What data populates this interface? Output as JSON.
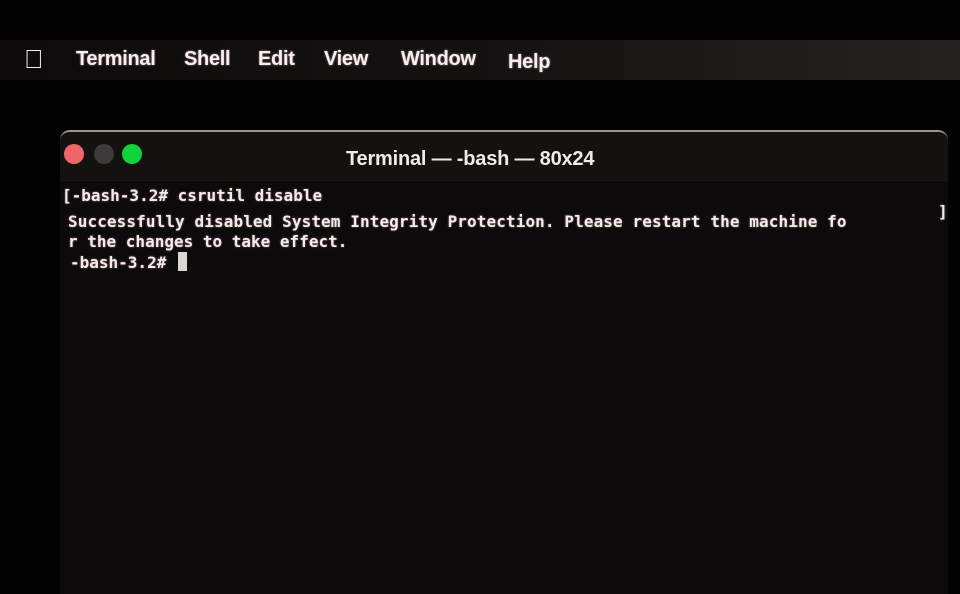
{
  "menubar": {
    "apple_icon": "apple-logo-icon",
    "items": [
      {
        "label": "Terminal"
      },
      {
        "label": "Shell"
      },
      {
        "label": "Edit"
      },
      {
        "label": "View"
      },
      {
        "label": "Window"
      },
      {
        "label": "Help"
      }
    ]
  },
  "window": {
    "title": "Terminal — -bash — 80x24",
    "traffic_lights": {
      "close": {
        "color": "#f06565"
      },
      "minimize": {
        "color": "#3c3a39"
      },
      "zoom": {
        "color": "#12d23a"
      }
    }
  },
  "terminal": {
    "lines": [
      "[-bash-3.2# csrutil disable",
      "Successfully disabled System Integrity Protection. Please restart the machine fo",
      "r the changes to take effect.",
      "-bash-3.2# "
    ],
    "right_bracket": "]"
  }
}
